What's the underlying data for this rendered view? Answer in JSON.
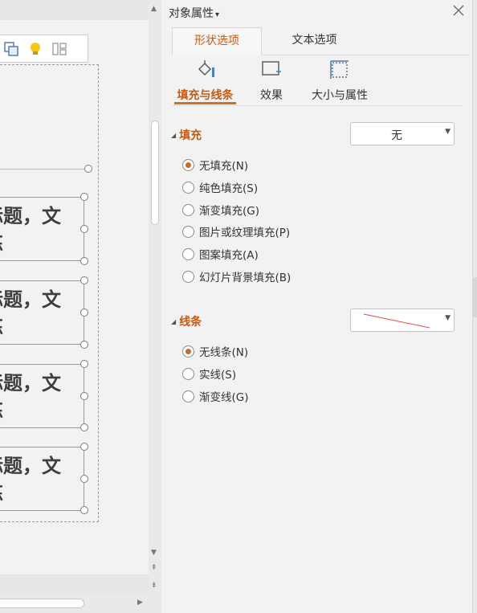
{
  "canvas": {
    "cards": [
      {
        "line1": "标题，文",
        "line2": "炼"
      },
      {
        "line1": "标题，文",
        "line2": "炼"
      },
      {
        "line1": "标题，文",
        "line2": "炼"
      },
      {
        "line1": "标题，文",
        "line2": "炼"
      }
    ],
    "toolbar": [
      "copy-shape-icon",
      "lightbulb-icon",
      "layout-icon"
    ]
  },
  "panel": {
    "title": "对象属性",
    "title_caret": "▾",
    "tabs": [
      {
        "label": "形状选项",
        "active": true
      },
      {
        "label": "文本选项",
        "active": false
      }
    ],
    "subtabs": [
      {
        "label": "填充与线条",
        "icon": "fill-bucket-icon",
        "active": true
      },
      {
        "label": "效果",
        "icon": "effect-icon",
        "active": false
      },
      {
        "label": "大小与属性",
        "icon": "size-icon",
        "active": false
      }
    ],
    "fill": {
      "title": "填充",
      "dropdown_value": "无",
      "options": [
        {
          "label": "无填充(N)",
          "checked": true
        },
        {
          "label": "纯色填充(S)",
          "checked": false
        },
        {
          "label": "渐变填充(G)",
          "checked": false
        },
        {
          "label": "图片或纹理填充(P)",
          "checked": false
        },
        {
          "label": "图案填充(A)",
          "checked": false
        },
        {
          "label": "幻灯片背景填充(B)",
          "checked": false
        }
      ]
    },
    "line": {
      "title": "线条",
      "preview_color": "#e8474f",
      "options": [
        {
          "label": "无线条(N)",
          "checked": true
        },
        {
          "label": "实线(S)",
          "checked": false
        },
        {
          "label": "渐变线(G)",
          "checked": false
        }
      ]
    }
  },
  "colors": {
    "accent": "#c85a0f",
    "underline": "#d4711c",
    "radio_dot": "#c86a2a"
  }
}
